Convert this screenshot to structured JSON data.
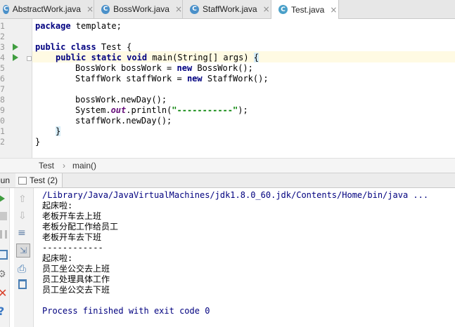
{
  "tabs": [
    {
      "label": "AbstractWork.java",
      "active": false
    },
    {
      "label": "BossWork.java",
      "active": false
    },
    {
      "label": "StaffWork.java",
      "active": false
    },
    {
      "label": "Test.java",
      "active": true
    }
  ],
  "tab_icon_letter": "C",
  "close_glyph": "×",
  "line_numbers": [
    "1",
    "2",
    "3",
    "4",
    "5",
    "6",
    "7",
    "8",
    "9",
    "0",
    "1",
    "2"
  ],
  "code": {
    "l1_kw": "package",
    "l1_rest": " template;",
    "l3_kw": "public class",
    "l3_rest": " Test {",
    "l4_kw": "public static void",
    "l4_rest": " main(String[] args) ",
    "l4_brace": "{",
    "l5_a": "BossWork bossWork = ",
    "l5_kw": "new",
    "l5_b": " BossWork();",
    "l6_a": "StaffWork staffWork = ",
    "l6_kw": "new",
    "l6_b": " StaffWork();",
    "l8": "bossWork.newDay();",
    "l9_a": "System.",
    "l9_fld": "out",
    "l9_b": ".println(",
    "l9_str": "\"-----------\"",
    "l9_c": ");",
    "l10": "staffWork.newDay();",
    "l11": "}",
    "l12": "}"
  },
  "breadcrumb": {
    "class": "Test",
    "sep": "›",
    "method": "main()"
  },
  "run_panel": {
    "label": "Run",
    "tab_label": "Test (2)"
  },
  "console_lines": [
    "/Library/Java/JavaVirtualMachines/jdk1.8.0_60.jdk/Contents/Home/bin/java ...",
    "起床啦:",
    "老板开车去上班",
    "老板分配工作给员工",
    "老板开车去下班",
    "------------",
    "起床啦:",
    "员工坐公交去上班",
    "员工处理具体工作",
    "员工坐公交去下班",
    "",
    "Process finished with exit code 0"
  ],
  "colors": {
    "keyword": "#000080",
    "string": "#008000",
    "console_cmd": "#00007f",
    "run_green": "#3f9d3f"
  }
}
